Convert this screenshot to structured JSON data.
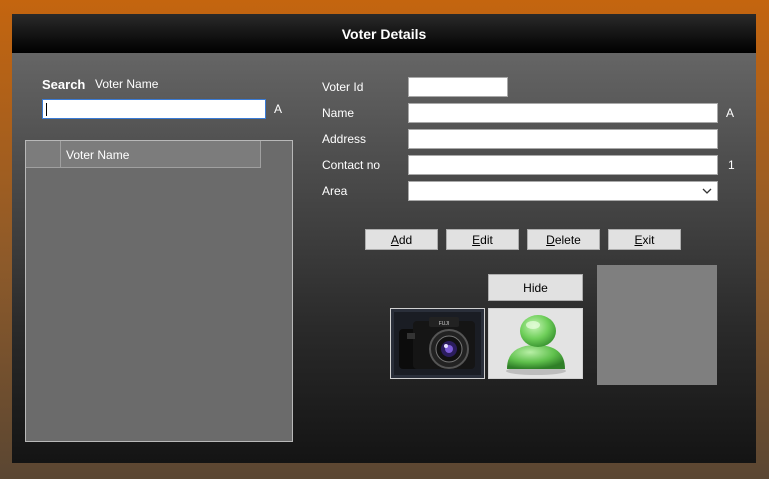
{
  "window": {
    "title": "Voter Details"
  },
  "search": {
    "label": "Search",
    "field_label": "Voter Name",
    "value": "",
    "suffix": "A"
  },
  "grid": {
    "columns": [
      "Voter Name"
    ],
    "rows": []
  },
  "form": {
    "voter_id": {
      "label": "Voter Id",
      "value": ""
    },
    "name": {
      "label": "Name",
      "value": "",
      "suffix": "A"
    },
    "address": {
      "label": "Address",
      "value": ""
    },
    "contact": {
      "label": "Contact no",
      "value": "",
      "suffix": "1"
    },
    "area": {
      "label": "Area",
      "value": ""
    }
  },
  "buttons": {
    "add": {
      "mnemonic": "A",
      "rest": "dd"
    },
    "edit": {
      "mnemonic": "E",
      "rest": "dit"
    },
    "delete": {
      "mnemonic": "D",
      "rest": "elete"
    },
    "exit": {
      "mnemonic": "E",
      "rest": "xit"
    },
    "hide": "Hide"
  },
  "images": {
    "camera_icon": "camera-icon",
    "user_icon": "user-avatar-icon"
  },
  "colors": {
    "background_top": "#c4650f",
    "titlebar": "#000000",
    "user_icon_green": "#6fcf5a"
  }
}
